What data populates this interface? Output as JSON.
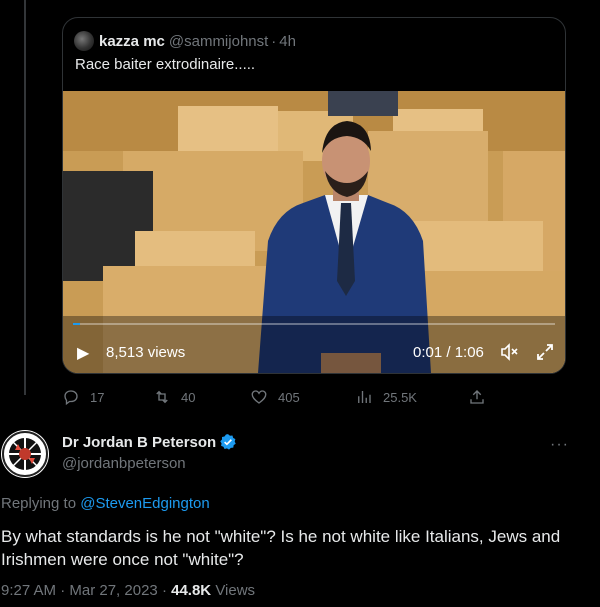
{
  "quote_tweet": {
    "author_name": "kazza mc",
    "author_handle": "@sammijohnst",
    "separator": "·",
    "time": "4h",
    "text": "Race baiter extrodinaire.....",
    "video": {
      "views": "8,513 views",
      "time": "0:01 / 1:06",
      "progress_fraction": 0.015
    }
  },
  "actions": {
    "reply_count": "17",
    "retweet_count": "40",
    "like_count": "405",
    "view_count": "25.5K"
  },
  "tweet": {
    "author_name": "Dr Jordan B Peterson",
    "author_handle": "@jordanbpeterson",
    "replying_prefix": "Replying to",
    "replying_to": "@StevenEdgington",
    "text": "By what standards is he not \"white\"? Is he not white like Italians, Jews and Irishmen were once not \"white\"?",
    "timestamp": "9:27 AM · Mar 27, 2023",
    "separator": "·",
    "views_count": "44.8K",
    "views_label": "Views"
  },
  "colors": {
    "background": "#000000",
    "primary_text": "#e7e9ea",
    "secondary_text": "#71767b",
    "accent": "#1d9bf0"
  },
  "icons": [
    "reply-icon",
    "retweet-icon",
    "like-icon",
    "views-icon",
    "share-icon",
    "verified-icon",
    "more-icon",
    "play-icon",
    "volume-mute-icon",
    "fullscreen-icon"
  ]
}
